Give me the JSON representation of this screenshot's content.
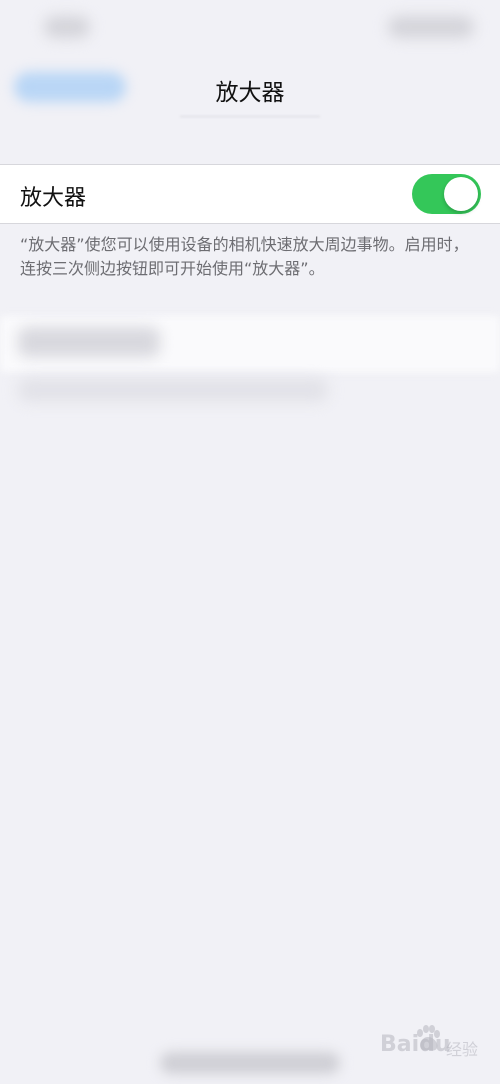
{
  "nav": {
    "title": "放大器"
  },
  "magnifier_row": {
    "label": "放大器",
    "toggle_on": true,
    "toggle_color": "#34c759"
  },
  "footer_note": "“放大器”使您可以使用设备的相机快速放大周边事物。启用时，连按三次侧边按钮即可开始使用“放大器”。",
  "watermark": {
    "text": "Baidu",
    "sub": "经验"
  },
  "icons": [
    "toggle-switch",
    "baidu-paw-icon"
  ]
}
